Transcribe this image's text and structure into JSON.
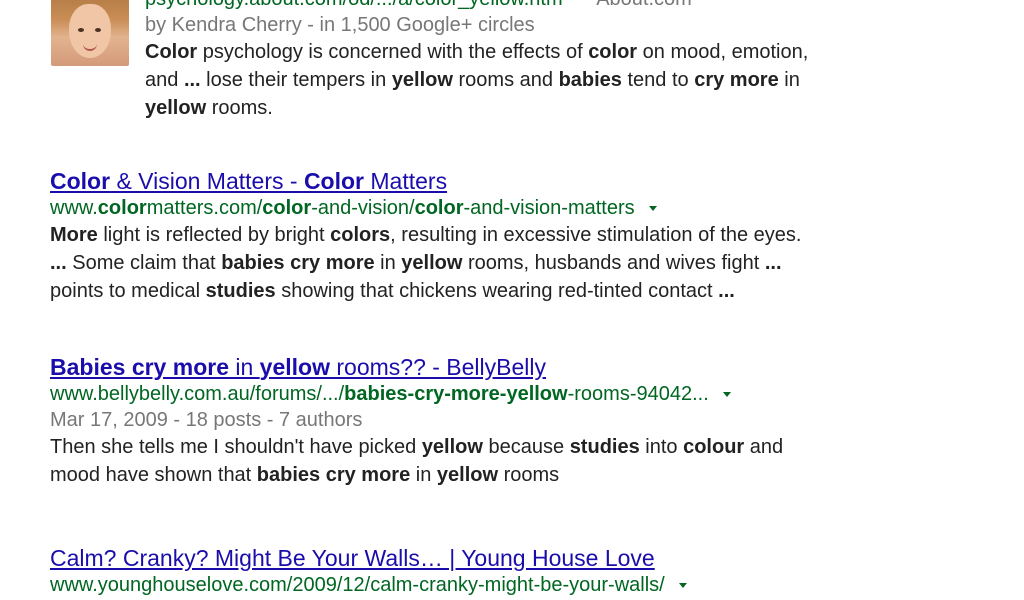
{
  "results": [
    {
      "url_text": "psychology.about.com/od/.../a/color_yellow.htm",
      "site_text": "About.com",
      "author": "by Kendra Cherry - in 1,500 Google+ circles",
      "snippet_parts": [
        [
          "b",
          "Color"
        ],
        [
          " psychology is concerned with the effects of "
        ],
        [
          "b",
          "color"
        ],
        [
          " on mood, emotion,"
        ],
        [
          "br"
        ],
        [
          "and "
        ],
        [
          "b",
          "..."
        ],
        [
          " lose their tempers in "
        ],
        [
          "b",
          "yellow"
        ],
        [
          " rooms and "
        ],
        [
          "b",
          "babies"
        ],
        [
          " tend to "
        ],
        [
          "b",
          "cry more"
        ],
        [
          " in"
        ],
        [
          "br"
        ],
        [
          "b",
          "yellow"
        ],
        [
          " rooms."
        ]
      ]
    },
    {
      "title_parts": [
        [
          "b",
          "Color"
        ],
        [
          " & Vision Matters - "
        ],
        [
          "b",
          "Color"
        ],
        [
          " Matters"
        ]
      ],
      "url_parts": [
        [
          "www."
        ],
        [
          "b",
          "color"
        ],
        [
          "matters.com/"
        ],
        [
          "b",
          "color"
        ],
        [
          "-and-vision/"
        ],
        [
          "b",
          "color"
        ],
        [
          "-and-vision-matters"
        ]
      ],
      "snippet_parts": [
        [
          "b",
          "More"
        ],
        [
          " light is reflected by bright "
        ],
        [
          "b",
          "colors"
        ],
        [
          ", resulting in excessive stimulation of the eyes."
        ],
        [
          "br"
        ],
        [
          "b",
          "..."
        ],
        [
          " Some claim that "
        ],
        [
          "b",
          "babies cry more"
        ],
        [
          " in "
        ],
        [
          "b",
          "yellow"
        ],
        [
          " rooms, husbands and wives fight "
        ],
        [
          "b",
          "..."
        ],
        [
          "br"
        ],
        [
          "points to medical "
        ],
        [
          "b",
          "studies"
        ],
        [
          " showing that chickens wearing red-tinted contact  "
        ],
        [
          "b",
          "..."
        ]
      ]
    },
    {
      "title_parts": [
        [
          "b",
          "Babies cry more"
        ],
        [
          " in "
        ],
        [
          "b",
          "yellow"
        ],
        [
          " rooms?? - BellyBelly"
        ]
      ],
      "url_parts": [
        [
          "www.bellybelly.com.au/forums/.../"
        ],
        [
          "b",
          "babies-cry-more-yellow"
        ],
        [
          "-rooms-94042..."
        ]
      ],
      "meta": "Mar 17, 2009 - 18 posts - 7 authors",
      "snippet_parts": [
        [
          "Then she tells me I shouldn't have picked "
        ],
        [
          "b",
          "yellow"
        ],
        [
          " because "
        ],
        [
          "b",
          "studies"
        ],
        [
          " into "
        ],
        [
          "b",
          "colour"
        ],
        [
          " and"
        ],
        [
          "br"
        ],
        [
          "mood have shown that "
        ],
        [
          "b",
          "babies cry more"
        ],
        [
          " in "
        ],
        [
          "b",
          "yellow"
        ],
        [
          " rooms"
        ]
      ]
    },
    {
      "title": "Calm? Cranky? Might Be Your Walls… | Young House Love",
      "url_text": "www.younghouselove.com/2009/12/calm-cranky-might-be-your-walls/"
    }
  ]
}
